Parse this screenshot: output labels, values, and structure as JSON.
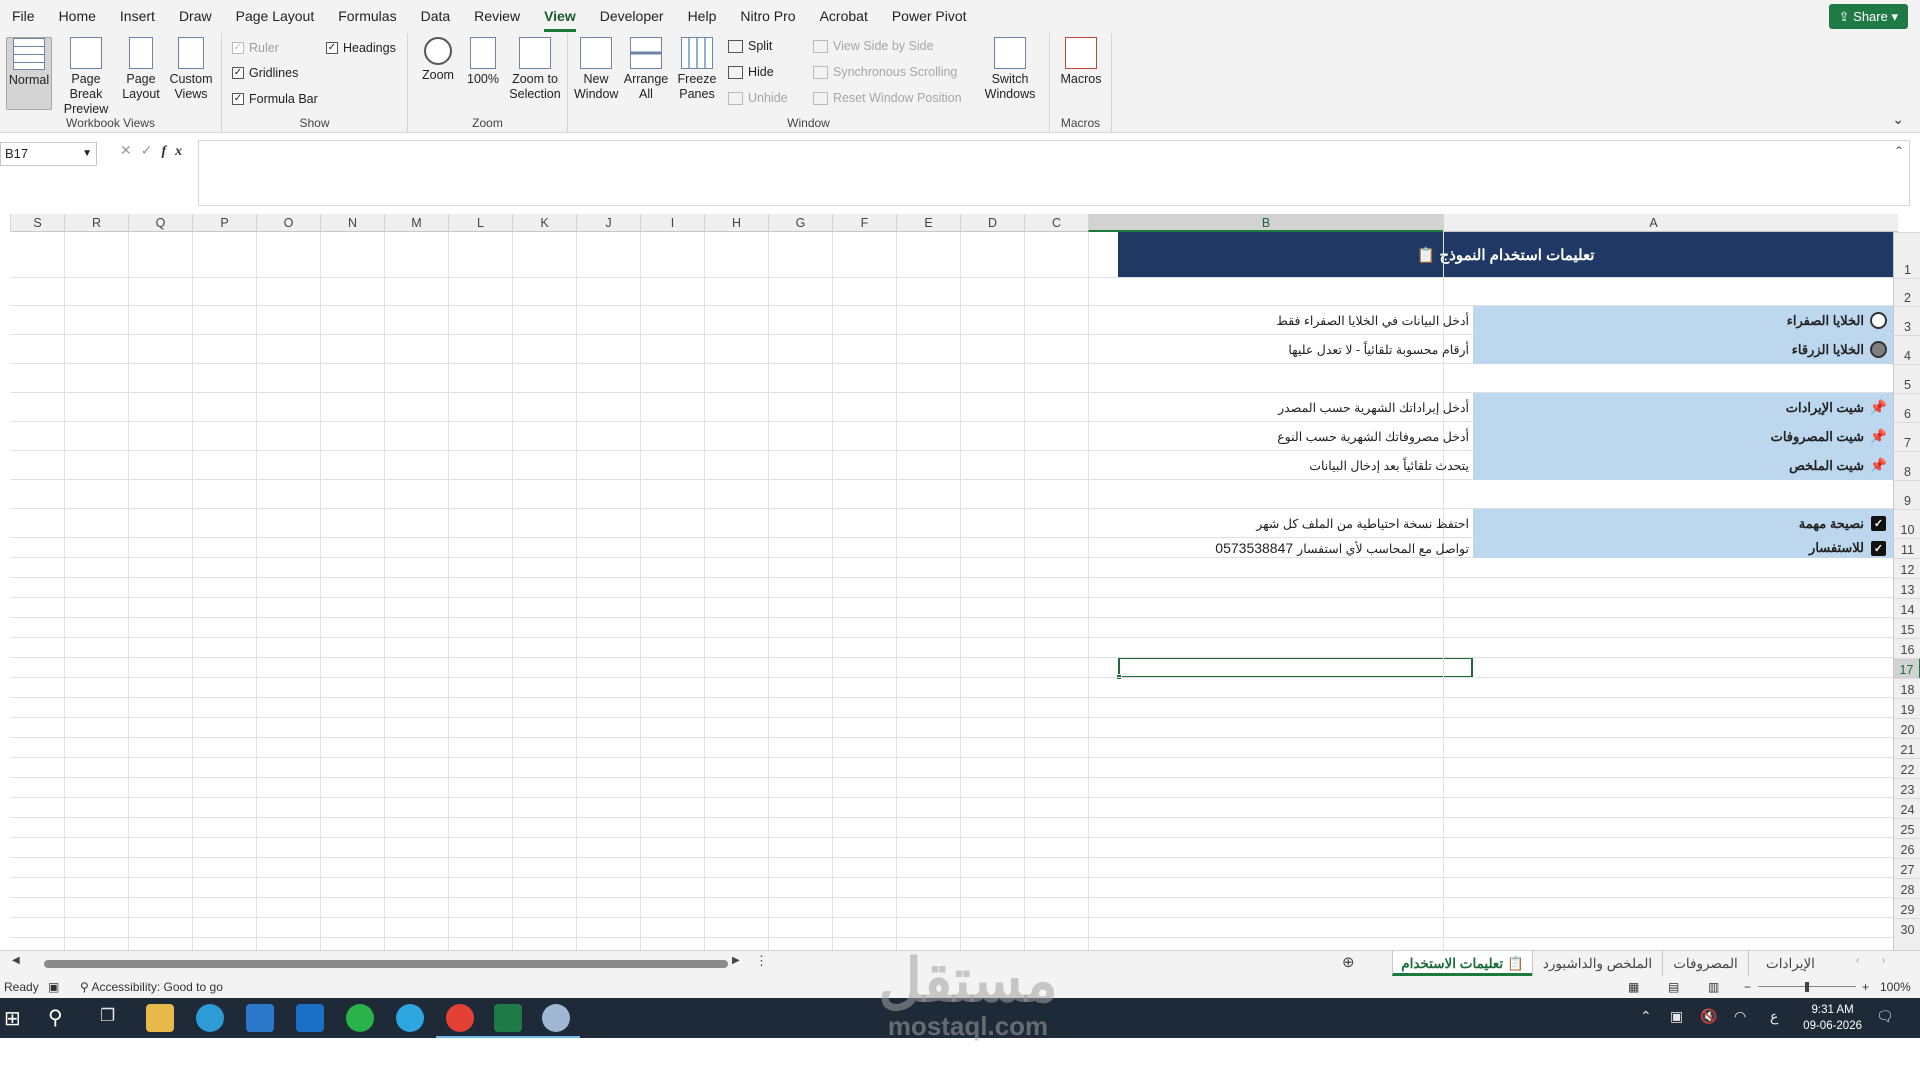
{
  "app": {
    "name": "Excel",
    "share_label": "Share"
  },
  "menu": [
    "File",
    "Home",
    "Insert",
    "Draw",
    "Page Layout",
    "Formulas",
    "Data",
    "Review",
    "View",
    "Developer",
    "Help",
    "Nitro Pro",
    "Acrobat",
    "Power Pivot"
  ],
  "menu_active": "View",
  "ribbon": {
    "workbook_views": {
      "label": "Workbook Views",
      "normal": "Normal",
      "page_break": "Page Break Preview",
      "page_layout": "Page Layout",
      "custom_views": "Custom Views"
    },
    "show": {
      "label": "Show",
      "ruler": "Ruler",
      "headings": "Headings",
      "gridlines": "Gridlines",
      "formula_bar": "Formula Bar"
    },
    "zoom": {
      "label": "Zoom",
      "zoom": "Zoom",
      "hundred": "100%",
      "zoom_to_selection": "Zoom to Selection"
    },
    "window": {
      "label": "Window",
      "new_window": "New Window",
      "arrange_all": "Arrange All",
      "freeze_panes": "Freeze Panes",
      "split": "Split",
      "hide": "Hide",
      "unhide": "Unhide",
      "view_side_by_side": "View Side by Side",
      "synchronous_scrolling": "Synchronous Scrolling",
      "reset_window_position": "Reset Window Position",
      "switch_windows": "Switch Windows"
    },
    "macros": {
      "label": "Macros",
      "macros": "Macros"
    }
  },
  "formula_bar": {
    "name_box": "B17",
    "fx": "fx",
    "content": ""
  },
  "columns": [
    "S",
    "R",
    "Q",
    "P",
    "O",
    "N",
    "M",
    "L",
    "K",
    "J",
    "I",
    "H",
    "G",
    "F",
    "E",
    "D",
    "C",
    "B",
    "A"
  ],
  "selected_column": "B",
  "selected_row": "17",
  "rows": [
    "1",
    "2",
    "3",
    "4",
    "5",
    "6",
    "7",
    "8",
    "9",
    "10",
    "11",
    "12",
    "13",
    "14",
    "15",
    "16",
    "17",
    "18",
    "19",
    "20",
    "21",
    "22",
    "23",
    "24",
    "25",
    "26",
    "27",
    "28",
    "29",
    "30"
  ],
  "sheet": {
    "title": "تعليمات استخدام النموذج 📋",
    "items": [
      {
        "row": "3",
        "label": "الخلايا الصفراء",
        "icon": "yellow-circle-icon",
        "desc": "أدخل البيانات في الخلايا الصفراء فقط"
      },
      {
        "row": "4",
        "label": "الخلايا الزرقاء",
        "icon": "blue-circle-icon",
        "desc": "أرقام محسوبة تلقائياً - لا تعدل عليها"
      },
      {
        "row": "6",
        "label": "شيت الإيرادات",
        "icon": "pin-icon",
        "desc": "أدخل إيراداتك الشهرية حسب المصدر"
      },
      {
        "row": "7",
        "label": "شيت المصروفات",
        "icon": "pin-icon",
        "desc": "أدخل مصروفاتك الشهرية حسب النوع"
      },
      {
        "row": "8",
        "label": "شيت الملخص",
        "icon": "pin-icon",
        "desc": "يتحدث تلقائياً بعد إدخال البيانات"
      },
      {
        "row": "10",
        "label": "نصيحة مهمة",
        "icon": "checkbox-icon",
        "desc": "احتفظ نسخة احتياطية من الملف كل شهر"
      },
      {
        "row": "11",
        "label": "للاستفسار",
        "icon": "checkbox-icon",
        "desc": "تواصل مع المحاسب لأي استفسار",
        "phone": "0573538847"
      }
    ]
  },
  "tabs": [
    {
      "label": "تعليمات الاستخدام",
      "active": true
    },
    {
      "label": "الملخص والداشبورد",
      "active": false
    },
    {
      "label": "المصروفات",
      "active": false
    },
    {
      "label": "الإيرادات",
      "active": false
    }
  ],
  "status": {
    "ready": "Ready",
    "accessibility": "Accessibility: Good to go",
    "zoom": "100%"
  },
  "taskbar": {
    "time": "9:31 AM",
    "date": "09-06-2026",
    "lang": "ع"
  },
  "watermark": {
    "line1": "مستقل",
    "line2": "mostaql.com"
  },
  "colors": {
    "title_band": "#203864",
    "label_band": "#bdd7ee",
    "accent": "#1d7a3e"
  }
}
